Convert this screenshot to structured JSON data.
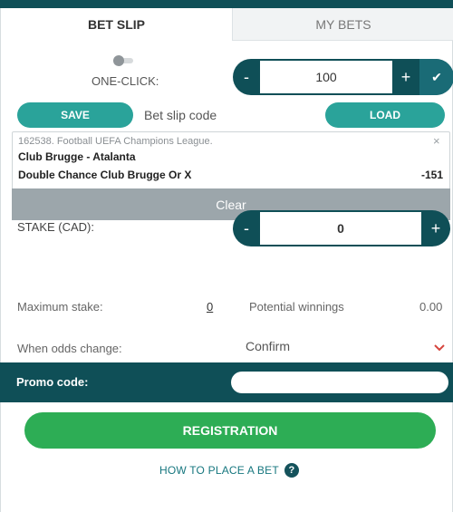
{
  "tabs": {
    "bet_slip": "BET SLIP",
    "my_bets": "MY BETS"
  },
  "one_click": {
    "label": "ONE-CLICK:",
    "value": "100",
    "minus": "-",
    "plus": "+",
    "confirm": "✔"
  },
  "actions": {
    "save": "SAVE",
    "code_label": "Bet slip code",
    "load": "LOAD"
  },
  "bet": {
    "meta": "162538. Football UEFA Champions League.",
    "event": "Club Brugge - Atalanta",
    "outcome": "Double Chance Club Brugge Or X",
    "odds": "-151",
    "close": "×"
  },
  "clear": "Clear",
  "stake": {
    "label": "STAKE (CAD):",
    "value": "0",
    "minus": "-",
    "plus": "+"
  },
  "limits": {
    "max_label": "Maximum stake:",
    "max_value": "0",
    "pot_label": "Potential winnings",
    "pot_value": "0.00"
  },
  "odds_change": {
    "label": "When odds change:",
    "value": "Confirm"
  },
  "promo": {
    "label": "Promo code:",
    "placeholder": ""
  },
  "registration": "REGISTRATION",
  "how_to": {
    "text": "HOW TO PLACE A BET",
    "icon_glyph": "?"
  },
  "colors": {
    "dark_teal": "#0f4f57",
    "teal": "#2aa39a",
    "green": "#2dad55",
    "grey": "#9ca6ab",
    "chevron_red": "#d6453d"
  }
}
